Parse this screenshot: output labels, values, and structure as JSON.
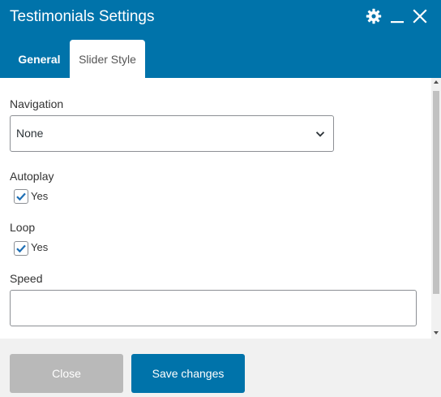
{
  "dialog": {
    "title": "Testimonials Settings"
  },
  "header_icons": [
    "gear-icon",
    "minimize-icon",
    "close-icon"
  ],
  "tabs": [
    {
      "label": "General",
      "active": false
    },
    {
      "label": "Slider Style",
      "active": true
    }
  ],
  "form": {
    "navigation": {
      "label": "Navigation",
      "value": "None"
    },
    "autoplay": {
      "label": "Autoplay",
      "checkbox_label": "Yes",
      "checked": true
    },
    "loop": {
      "label": "Loop",
      "checkbox_label": "Yes",
      "checked": true
    },
    "speed": {
      "label": "Speed",
      "value": ""
    }
  },
  "footer": {
    "close_label": "Close",
    "save_label": "Save changes"
  },
  "colors": {
    "header": "#0073aa",
    "primary_button": "#0073aa",
    "disabled_button": "#b9b9b9",
    "footer_bg": "#f1f1f1",
    "checkmark": "#1e6fb5"
  }
}
